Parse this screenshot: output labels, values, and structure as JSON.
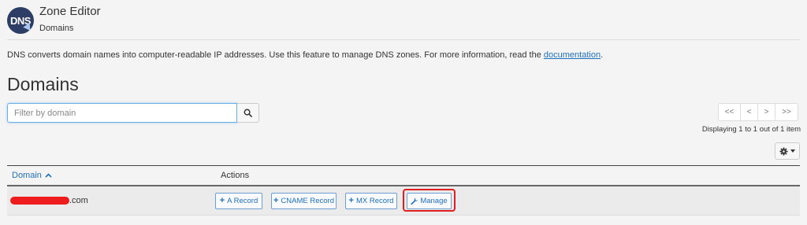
{
  "header": {
    "logo_text": "DNS",
    "title": "Zone Editor",
    "subtitle": "Domains"
  },
  "description": {
    "text": "DNS converts domain names into computer-readable IP addresses. Use this feature to manage DNS zones. For more information, read the ",
    "link": "documentation",
    "end": "."
  },
  "page_title": "Domains",
  "search": {
    "placeholder": "Filter by domain",
    "value": ""
  },
  "pagination": {
    "first": "<<",
    "prev": "<",
    "next": ">",
    "last": ">>",
    "info": "Displaying 1 to 1 out of 1 item"
  },
  "table": {
    "headers": {
      "domain": "Domain",
      "actions": "Actions"
    },
    "rows": [
      {
        "domain_visible": ".com",
        "actions": [
          "A Record",
          "CNAME Record",
          "MX Record",
          "Manage"
        ]
      }
    ]
  },
  "colors": {
    "accent": "#1f6fbf",
    "highlight": "#e02020",
    "redaction": "#ee1c1c"
  }
}
